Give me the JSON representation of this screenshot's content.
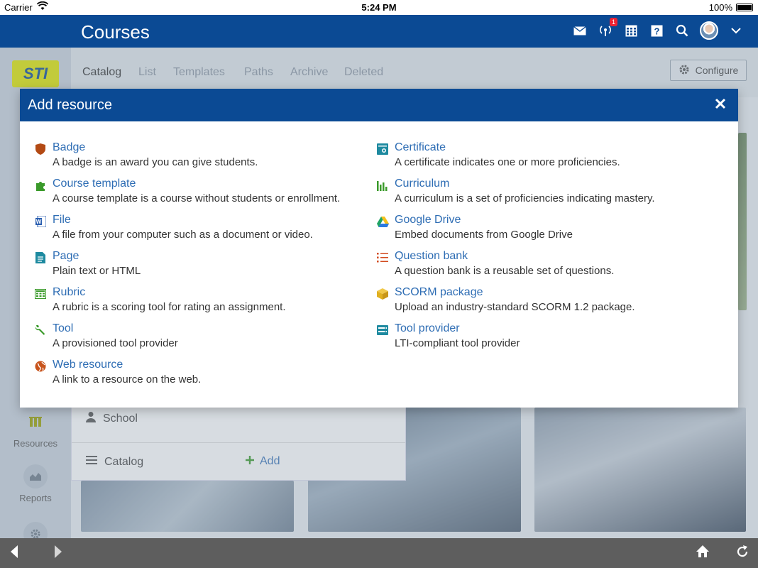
{
  "status_bar": {
    "carrier": "Carrier",
    "time": "5:24 PM",
    "battery": "100%"
  },
  "header": {
    "title": "Courses",
    "notification_count": "1"
  },
  "tabs": [
    "Catalog",
    "List",
    "Templates",
    "Paths",
    "Archive",
    "Deleted"
  ],
  "configure_label": "Configure",
  "sidebar": {
    "logo": "STI",
    "resources_label": "Resources",
    "reports_label": "Reports"
  },
  "panel": {
    "school_label": "School",
    "catalog_label": "Catalog",
    "add_label": "Add"
  },
  "modal": {
    "title": "Add resource",
    "left": [
      {
        "name": "Badge",
        "desc": "A badge is an award you can give students.",
        "icon": "badge-icon",
        "color": "#b34a14"
      },
      {
        "name": "Course template",
        "desc": "A course template is a course without students or enrollment.",
        "icon": "puzzle-icon",
        "color": "#3a9a2a"
      },
      {
        "name": "File",
        "desc": "A file from your computer such as a document or video.",
        "icon": "word-doc-icon",
        "color": "#2b5fb0"
      },
      {
        "name": "Page",
        "desc": "Plain text or HTML",
        "icon": "page-icon",
        "color": "#1e8aa0"
      },
      {
        "name": "Rubric",
        "desc": "A rubric is a scoring tool for rating an assignment.",
        "icon": "rubric-icon",
        "color": "#3a9a2a"
      },
      {
        "name": "Tool",
        "desc": "A provisioned tool provider",
        "icon": "wrench-icon",
        "color": "#3a9a2a"
      },
      {
        "name": "Web resource",
        "desc": "A link to a resource on the web.",
        "icon": "globe-icon",
        "color": "#c8541c"
      }
    ],
    "right": [
      {
        "name": "Certificate",
        "desc": "A certificate indicates one or more proficiencies.",
        "icon": "certificate-icon",
        "color": "#1e8aa0"
      },
      {
        "name": "Curriculum",
        "desc": "A curriculum is a set of proficiencies indicating mastery.",
        "icon": "bar-chart-icon",
        "color": "#3a9a2a"
      },
      {
        "name": "Google Drive",
        "desc": "Embed documents from Google Drive",
        "icon": "google-drive-icon",
        "color": "#2b7ae0"
      },
      {
        "name": "Question bank",
        "desc": "A question bank is a reusable set of questions.",
        "icon": "question-list-icon",
        "color": "#d24a1e"
      },
      {
        "name": "SCORM package",
        "desc": "Upload an industry-standard SCORM 1.2 package.",
        "icon": "package-icon",
        "color": "#e0b020"
      },
      {
        "name": "Tool provider",
        "desc": "LTI-compliant tool provider",
        "icon": "tool-provider-icon",
        "color": "#1e8aa0"
      }
    ]
  }
}
